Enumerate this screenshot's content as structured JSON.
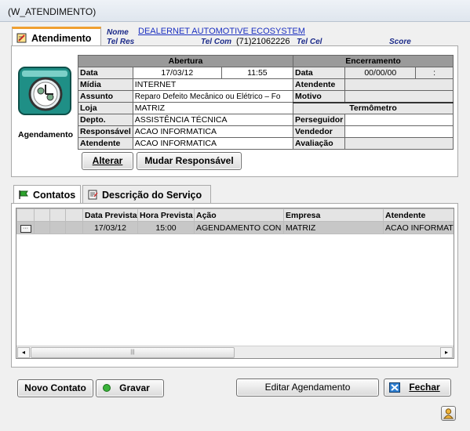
{
  "window": {
    "title": "(W_ATENDIMENTO)"
  },
  "tabs_top": {
    "atendimento": "Atendimento"
  },
  "header": {
    "nome_label": "Nome",
    "nome_value": "DEALERNET AUTOMOTIVE ECOSYSTEM",
    "telres_label": "Tel Res",
    "telcom_label": "Tel Com",
    "telcom_value": "(71)21062226",
    "telcel_label": "Tel Cel",
    "score_label": "Score"
  },
  "agendamento_label": "Agendamento",
  "abertura": {
    "title": "Abertura",
    "data_label": "Data",
    "data_value": "17/03/12",
    "hora_value": "11:55",
    "midia_label": "Mídia",
    "midia_value": "INTERNET",
    "assunto_label": "Assunto",
    "assunto_value": "Reparo Defeito Mecânico ou Elétrico – Fo",
    "loja_label": "Loja",
    "loja_value": "MATRIZ",
    "depto_label": "Depto.",
    "depto_value": "ASSISTÊNCIA TÉCNICA",
    "responsavel_label": "Responsável",
    "responsavel_value": "ACAO INFORMATICA",
    "atendente_label": "Atendente",
    "atendente_value": "ACAO INFORMATICA"
  },
  "encerramento": {
    "title": "Encerramento",
    "data_label": "Data",
    "data_value": "00/00/00",
    "hora_value": ":",
    "atendente_label": "Atendente",
    "motivo_label": "Motivo",
    "termometro_title": "Termômetro",
    "perseguidor_label": "Perseguidor",
    "vendedor_label": "Vendedor",
    "avaliacao_label": "Avaliação"
  },
  "buttons": {
    "alterar": "Alterar",
    "mudar_responsavel": "Mudar Responsável",
    "novo_contato": "Novo Contato",
    "gravar": "Gravar",
    "editar_agendamento": "Editar Agendamento",
    "fechar": "Fechar"
  },
  "tabs_bottom": {
    "contatos": "Contatos",
    "descricao": "Descrição do Serviço"
  },
  "list": {
    "columns": [
      "Data Prevista",
      "Hora Prevista",
      "Ação",
      "Empresa",
      "Atendente"
    ],
    "rows": [
      [
        "17/03/12",
        "15:00",
        "AGENDAMENTO CON",
        "MATRIZ",
        "ACAO INFORMAT"
      ]
    ]
  },
  "colors": {
    "accent_teal": "#1f8f86",
    "link_blue": "#1c30c0",
    "label_navy": "#1d2c8a"
  }
}
